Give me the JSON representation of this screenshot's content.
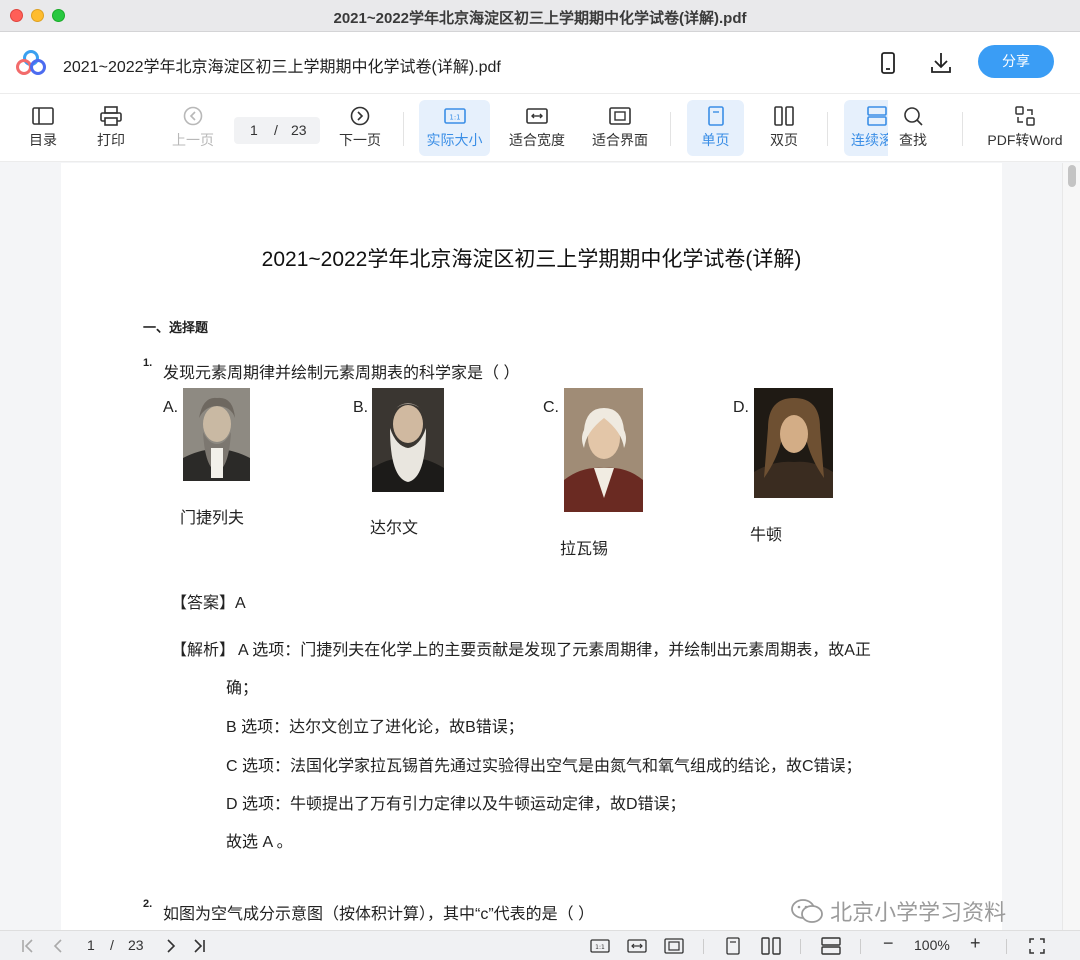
{
  "window": {
    "title": "2021~2022学年北京海淀区初三上学期期中化学试卷(详解).pdf"
  },
  "header": {
    "doc_title": "2021~2022学年北京海淀区初三上学期期中化学试卷(详解).pdf",
    "share_label": "分享",
    "icons": [
      "app-logo",
      "phone-icon",
      "download-icon"
    ]
  },
  "toolbar": {
    "toc": "目录",
    "print": "打印",
    "prev": "上一页",
    "page_current": "1",
    "page_sep": "/",
    "page_total": "23",
    "next": "下一页",
    "actual_size": "实际大小",
    "fit_width": "适合宽度",
    "fit_page": "适合界面",
    "single_page": "单页",
    "double_page": "双页",
    "continuous": "连续滚",
    "find": "查找",
    "pdf_to_word": "PDF转Word"
  },
  "document": {
    "title": "2021~2022学年北京海淀区初三上学期期中化学试卷(详解)",
    "section": "一、选择题",
    "q1": {
      "num": "1.",
      "text": "发现元素周期律并绘制元素周期表的科学家是（    ）",
      "options": [
        {
          "letter": "A.",
          "name": "门捷列夫"
        },
        {
          "letter": "B.",
          "name": "达尔文"
        },
        {
          "letter": "C.",
          "name": "拉瓦锡"
        },
        {
          "letter": "D.",
          "name": "牛顿"
        }
      ],
      "answer": "【答案】A",
      "analysis_head": "【解析】",
      "analysis_a1": "A 选项：门捷列夫在化学上的主要贡献是发现了元素周期律，并绘制出元素周期表，故A正",
      "analysis_a2": "确；",
      "analysis_b": "B 选项：达尔文创立了进化论，故B错误；",
      "analysis_c": "C 选项：法国化学家拉瓦锡首先通过实验得出空气是由氮气和氧气组成的结论，故C错误；",
      "analysis_d": "D 选项：牛顿提出了万有引力定律以及牛顿运动定律，故D错误；",
      "conclusion": "故选 A 。"
    },
    "q2": {
      "num": "2.",
      "text": "如图为空气成分示意图（按体积计算），其中“c”代表的是（    ）"
    }
  },
  "bottombar": {
    "page_current": "1",
    "page_sep": "/",
    "page_total": "23",
    "zoom": "100%",
    "zoom_out": "−",
    "zoom_in": "+"
  },
  "watermark": "北京小学学习资料",
  "colors": {
    "accent": "#3a9df5",
    "active_bg": "#e6f0fc",
    "active_text": "#3a8ee6"
  }
}
